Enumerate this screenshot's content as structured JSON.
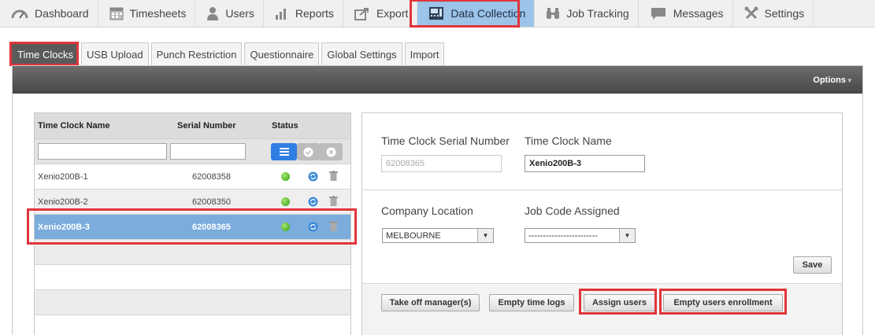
{
  "nav": {
    "items": [
      {
        "label": "Dashboard",
        "icon": "gauge-icon"
      },
      {
        "label": "Timesheets",
        "icon": "calendar-icon"
      },
      {
        "label": "Users",
        "icon": "user-icon"
      },
      {
        "label": "Reports",
        "icon": "bar-chart-icon"
      },
      {
        "label": "Export",
        "icon": "export-icon"
      },
      {
        "label": "Data Collection",
        "icon": "time-clock-icon",
        "active": true
      },
      {
        "label": "Job Tracking",
        "icon": "binoculars-icon"
      },
      {
        "label": "Messages",
        "icon": "chat-bubble-icon"
      },
      {
        "label": "Settings",
        "icon": "tools-icon"
      }
    ]
  },
  "subtabs": [
    "Time Clocks",
    "USB Upload",
    "Punch Restriction",
    "Questionnaire",
    "Global Settings",
    "Import"
  ],
  "panel": {
    "options_label": "Options"
  },
  "list": {
    "headers": {
      "name": "Time Clock Name",
      "serial": "Serial Number",
      "status": "Status"
    },
    "rows": [
      {
        "name": "Xenio200B-1",
        "serial": "62008358",
        "status": "online"
      },
      {
        "name": "Xenio200B-2",
        "serial": "62008350",
        "status": "online"
      },
      {
        "name": "Xenio200B-3",
        "serial": "62008365",
        "status": "online",
        "selected": true
      }
    ]
  },
  "form": {
    "serial_label": "Time Clock Serial Number",
    "serial_value": "62008365",
    "name_label": "Time Clock Name",
    "name_value": "Xenio200B-3",
    "location_label": "Company Location",
    "location_value": "MELBOURNE",
    "jobcode_label": "Job Code Assigned",
    "jobcode_value": "------------------------",
    "save_label": "Save",
    "take_off_label": "Take off manager(s)",
    "empty_logs_label": "Empty time logs",
    "assign_users_label": "Assign users",
    "empty_enroll_label": "Empty users enrollment"
  },
  "colors": {
    "highlight": "#e0353b",
    "active_nav": "#9cc3e8",
    "selected_row": "#7bacdc",
    "filter_all": "#2f7ee3"
  }
}
